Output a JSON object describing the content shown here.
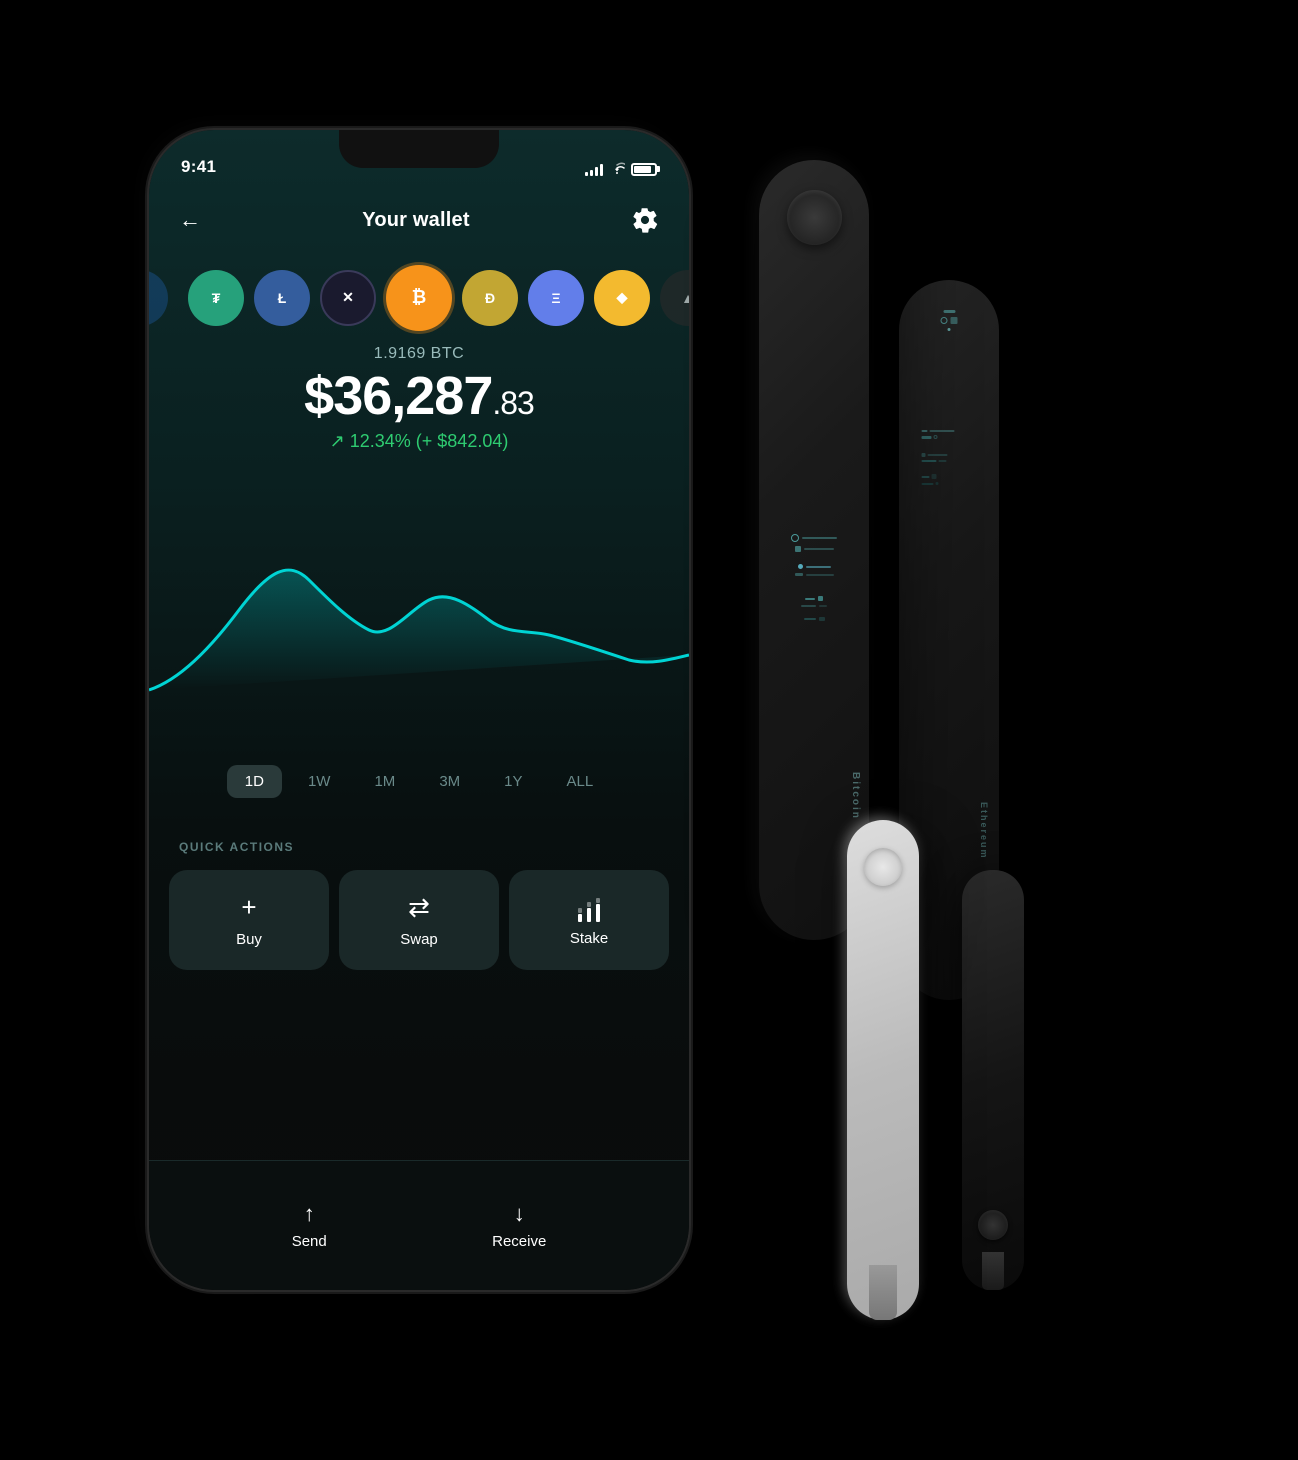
{
  "statusBar": {
    "time": "9:41",
    "signalBars": [
      4,
      6,
      8,
      10,
      12
    ],
    "batteryLevel": 85
  },
  "header": {
    "backLabel": "←",
    "title": "Your wallet",
    "settingsLabel": "⚙"
  },
  "coins": [
    {
      "id": "partial",
      "symbol": "",
      "bg": "#1a4f8a",
      "color": "#fff",
      "partial": true
    },
    {
      "id": "tether",
      "symbol": "₮",
      "bg": "#26a17b",
      "color": "#fff"
    },
    {
      "id": "litecoin",
      "symbol": "Ł",
      "bg": "#345d9d",
      "color": "#fff"
    },
    {
      "id": "xrp",
      "symbol": "✕",
      "bg": "#2a2a3a",
      "color": "#fff"
    },
    {
      "id": "bitcoin",
      "symbol": "₿",
      "bg": "#f7931a",
      "color": "#fff",
      "active": true
    },
    {
      "id": "dogecoin",
      "symbol": "Ð",
      "bg": "#c2a633",
      "color": "#fff"
    },
    {
      "id": "ethereum",
      "symbol": "Ξ",
      "bg": "#627eea",
      "color": "#fff"
    },
    {
      "id": "binance",
      "symbol": "◆",
      "bg": "#f3ba2f",
      "color": "#fff"
    },
    {
      "id": "algo",
      "symbol": "A",
      "bg": "#3a3a3a",
      "color": "#fff"
    }
  ],
  "priceData": {
    "amount": "1.9169 BTC",
    "priceMain": "$36,287",
    "priceCents": ".83",
    "change": "↗ 12.34% (+ $842.04)"
  },
  "timeButtons": [
    {
      "label": "1D",
      "active": true
    },
    {
      "label": "1W",
      "active": false
    },
    {
      "label": "1M",
      "active": false
    },
    {
      "label": "3M",
      "active": false
    },
    {
      "label": "1Y",
      "active": false
    },
    {
      "label": "ALL",
      "active": false
    }
  ],
  "quickActions": {
    "label": "QUICK ACTIONS",
    "buttons": [
      {
        "id": "buy",
        "icon": "+",
        "label": "Buy"
      },
      {
        "id": "swap",
        "icon": "⇄",
        "label": "Swap"
      },
      {
        "id": "stake",
        "icon": "↑↑",
        "label": "Stake"
      }
    ]
  },
  "bottomBar": {
    "send": {
      "icon": "↑",
      "label": "Send"
    },
    "receive": {
      "icon": "↓",
      "label": "Receive"
    }
  },
  "ledger": {
    "bitcoinLabel": "Bitcoin",
    "ethereumLabel": "Ethereum"
  }
}
